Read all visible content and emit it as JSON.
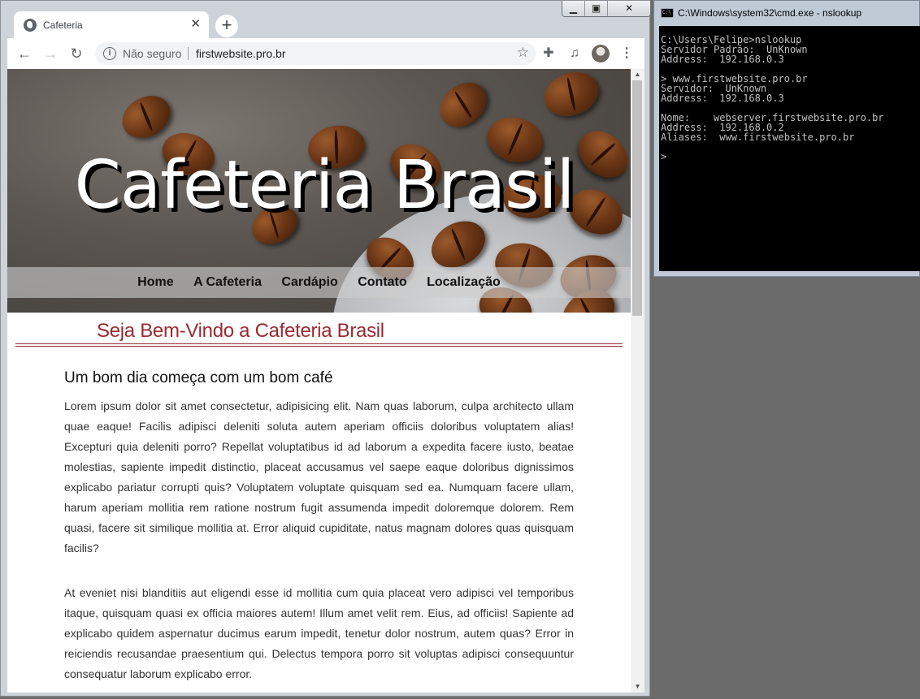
{
  "browser": {
    "tab": {
      "title": "Cafeteria",
      "icon": "globe-icon",
      "close_icon": "close-icon"
    },
    "new_tab_icon": "plus-icon",
    "window_controls": {
      "minimize": "minimize-icon",
      "maximize": "maximize-icon",
      "close": "close-icon"
    },
    "toolbar": {
      "back_icon": "back-arrow-icon",
      "forward_icon": "forward-arrow-icon",
      "reload_icon": "reload-icon",
      "security_label": "Não seguro",
      "url": "firstwebsite.pro.br",
      "bookmark_icon": "star-icon",
      "extensions_icon": "puzzle-icon",
      "media_icon": "media-queue-icon",
      "profile_icon": "avatar",
      "menu_icon": "kebab-menu-icon"
    }
  },
  "site": {
    "hero_title": "Cafeteria Brasil",
    "nav": [
      "Home",
      "A Cafeteria",
      "Cardápio",
      "Contato",
      "Localização"
    ],
    "welcome": "Seja Bem-Vindo a Cafeteria Brasil",
    "heading": "Um bom dia começa com um bom café",
    "paragraphs": [
      "Lorem ipsum dolor sit amet consectetur, adipisicing elit. Nam quas laborum, culpa architecto ullam quae eaque! Facilis adipisci deleniti soluta autem aperiam officiis doloribus voluptatem alias! Excepturi quia deleniti porro? Repellat voluptatibus id ad laborum a expedita facere iusto, beatae molestias, sapiente impedit distinctio, placeat accusamus vel saepe eaque doloribus dignissimos explicabo pariatur corrupti quis? Voluptatem voluptate quisquam sed ea. Numquam facere ullam, harum aperiam mollitia rem ratione nostrum fugit assumenda impedit doloremque dolorem. Rem quasi, facere sit similique mollitia at. Error aliquid cupiditate, natus magnam dolores quas quisquam facilis?",
      "At eveniet nisi blanditiis aut eligendi esse id mollitia cum quia placeat vero adipisci vel temporibus itaque, quisquam quasi ex officia maiores autem! Illum amet velit rem. Eius, ad officiis! Sapiente ad explicabo quidem aspernatur ducimus earum impedit, tenetur dolor nostrum, autem quas? Error in reiciendis recusandae praesentium qui. Delectus tempora porro sit voluptas adipisci consequuntur consequatur laborum explicabo error."
    ]
  },
  "cmd": {
    "title": "C:\\Windows\\system32\\cmd.exe - nslookup",
    "lines": [
      "C:\\Users\\Felipe>nslookup",
      "Servidor Padrão:  UnKnown",
      "Address:  192.168.0.3",
      "",
      "> www.firstwebsite.pro.br",
      "Servidor:  UnKnown",
      "Address:  192.168.0.3",
      "",
      "Nome:    webserver.firstwebsite.pro.br",
      "Address:  192.168.0.2",
      "Aliases:  www.firstwebsite.pro.br",
      "",
      ">"
    ]
  }
}
